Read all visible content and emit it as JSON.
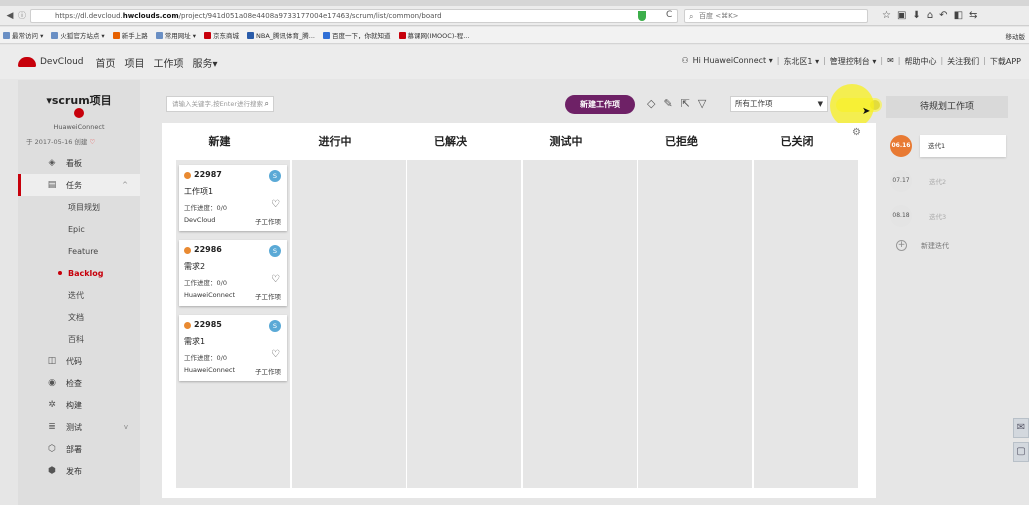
{
  "browser": {
    "url_prefix": "https://dl.devcloud.",
    "url_domain": "hwclouds.com",
    "url_path": "/project/941d051a08e4408a9733177004e17463/scrum/list/common/board",
    "search_placeholder": "百度 <⌘K>",
    "bookmarks": [
      "最常访问 ▾",
      "火狐官方站点 ▾",
      "新手上路",
      "常用网址 ▾",
      "京东商城",
      "NBA_腾讯体育_腾...",
      "百度一下，你就知道",
      "慕课网(IMOOC)-程..."
    ],
    "bookmark_colors": [
      "#6a8fc4",
      "#6a8fc4",
      "#e66000",
      "#6a8fc4",
      "#c7000b",
      "#2a5caa",
      "#2f6fd6",
      "#c7000b"
    ],
    "mobile_bookmarks": "移动版"
  },
  "app": {
    "logo": "DevCloud",
    "nav": [
      "首页",
      "项目",
      "工作项",
      "服务▾"
    ],
    "user": "Hi HuaweiConnect ▾",
    "region": "东北区1 ▾",
    "console": "管理控制台 ▾",
    "help": "帮助中心",
    "follow": "关注我们",
    "download": "下载APP",
    "separator": "|"
  },
  "project": {
    "title": "▾scrum项目",
    "owner": "HuaweiConnect",
    "created": "于 2017-05-16 创建"
  },
  "sidebar": {
    "items": [
      {
        "icon": "dashboard-icon",
        "glyph": "◈",
        "label": "看板"
      },
      {
        "icon": "task-icon",
        "glyph": "▤",
        "label": "任务",
        "chev": "^"
      },
      {
        "icon": "code-icon",
        "glyph": "◫",
        "label": "代码"
      },
      {
        "icon": "check-icon",
        "glyph": "◉",
        "label": "检查"
      },
      {
        "icon": "build-icon",
        "glyph": "✲",
        "label": "构建"
      },
      {
        "icon": "test-icon",
        "glyph": "≣",
        "label": "测试",
        "chev": "v"
      },
      {
        "icon": "deploy-icon",
        "glyph": "⬡",
        "label": "部署"
      },
      {
        "icon": "release-icon",
        "glyph": "⬢",
        "label": "发布"
      }
    ],
    "subitems": [
      "项目规划",
      "Epic",
      "Feature",
      "Backlog",
      "迭代",
      "文档",
      "百科"
    ]
  },
  "toolbar": {
    "search_placeholder": "请输入关键字,按Enter进行搜索",
    "new_button": "新建工作项",
    "filter": "所有工作项"
  },
  "board": {
    "columns": [
      "新建",
      "进行中",
      "已解决",
      "测试中",
      "已拒绝",
      "已关闭"
    ],
    "cards": [
      {
        "id": "22987",
        "badge": "S",
        "title": "工作项1",
        "progress": "工作进度：0/0",
        "owner": "DevCloud",
        "type": "子工作项"
      },
      {
        "id": "22986",
        "badge": "S",
        "title": "需求2",
        "progress": "工作进度：0/0",
        "owner": "HuaweiConnect",
        "type": "子工作项"
      },
      {
        "id": "22985",
        "badge": "S",
        "title": "需求1",
        "progress": "工作进度：0/0",
        "owner": "HuaweiConnect",
        "type": "子工作项"
      }
    ]
  },
  "iterations_panel": {
    "title": "待规划工作项",
    "iterations": [
      {
        "date": "06.16",
        "name": "迭代1"
      },
      {
        "date": "07.17",
        "name": "迭代2"
      },
      {
        "date": "08.18",
        "name": "迭代3"
      }
    ],
    "add_label": "新建迭代"
  },
  "colors": {
    "brand_red": "#c7000b",
    "primary_button": "#6e2166",
    "active_iteration": "#e87a33",
    "card_dot": "#e98a32",
    "badge_blue": "#5aa9d6"
  }
}
